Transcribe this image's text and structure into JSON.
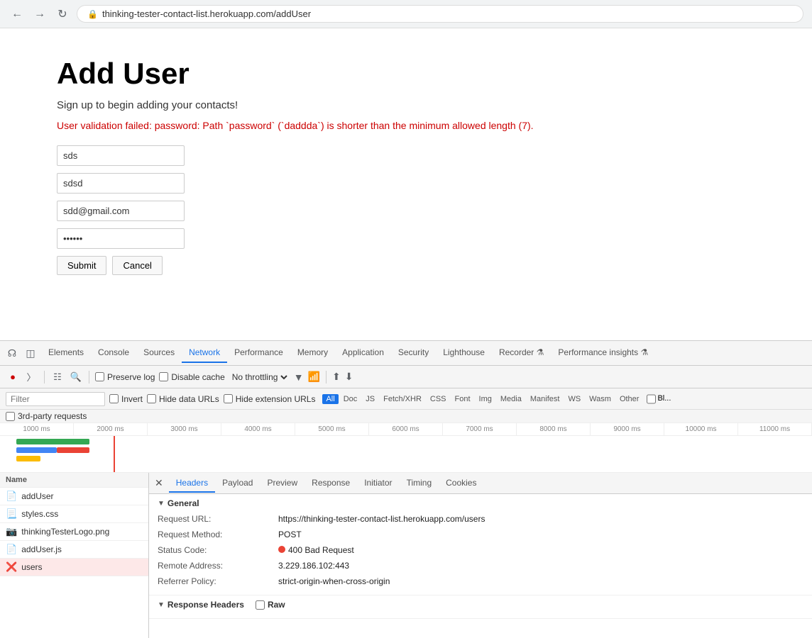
{
  "browser": {
    "back_title": "Back",
    "forward_title": "Forward",
    "refresh_title": "Refresh",
    "url": "thinking-tester-contact-list.herokuapp.com/addUser",
    "lock_icon": "🔒"
  },
  "page": {
    "title": "Add User",
    "subtitle": "Sign up to begin adding your contacts!",
    "error": "User validation failed: password: Path `password` (`daddda`) is shorter than the minimum allowed length (7).",
    "fields": {
      "username": "sds",
      "firstname": "sdsd",
      "email": "sdd@gmail.com",
      "password": "••••••"
    },
    "buttons": {
      "submit": "Submit",
      "cancel": "Cancel"
    }
  },
  "devtools": {
    "tabs": [
      "Elements",
      "Console",
      "Sources",
      "Network",
      "Performance",
      "Memory",
      "Application",
      "Security",
      "Lighthouse",
      "Recorder ⚗",
      "Performance insights ⚗"
    ],
    "active_tab": "Network",
    "toolbar": {
      "preserve_log": "Preserve log",
      "disable_cache": "Disable cache",
      "no_throttling": "No throttling",
      "online_icon": "📶",
      "upload_icon": "⬆",
      "download_icon": "⬇"
    },
    "filter_bar": {
      "placeholder": "Filter",
      "invert": "Invert",
      "hide_data_urls": "Hide data URLs",
      "hide_ext_urls": "Hide extension URLs",
      "types": [
        "All",
        "Doc",
        "JS",
        "Fetch/XHR",
        "CSS",
        "Font",
        "Img",
        "Media",
        "Manifest",
        "WS",
        "Wasm",
        "Other",
        "Bl..."
      ],
      "active_type": "All"
    },
    "third_party": "3rd-party requests",
    "timeline": {
      "marks": [
        "1000 ms",
        "2000 ms",
        "3000 ms",
        "4000 ms",
        "5000 ms",
        "6000 ms",
        "7000 ms",
        "8000 ms",
        "9000 ms",
        "10000 ms",
        "11000 ms"
      ]
    },
    "files": [
      {
        "name": "addUser",
        "icon": "doc",
        "type": "doc"
      },
      {
        "name": "styles.css",
        "icon": "css",
        "type": "css"
      },
      {
        "name": "thinkingTesterLogo.png",
        "icon": "img",
        "type": "img"
      },
      {
        "name": "addUser.js",
        "icon": "js",
        "type": "js"
      },
      {
        "name": "users",
        "icon": "error",
        "type": "error",
        "selected": true
      }
    ],
    "headers_panel": {
      "close": "✕",
      "tabs": [
        "Headers",
        "Payload",
        "Preview",
        "Response",
        "Initiator",
        "Timing",
        "Cookies"
      ],
      "active_tab": "Headers",
      "general_section": "General",
      "general_fields": [
        {
          "key": "Request URL:",
          "value": "https://thinking-tester-contact-list.herokuapp.com/users"
        },
        {
          "key": "Request Method:",
          "value": "POST"
        },
        {
          "key": "Status Code:",
          "value": "400 Bad Request",
          "has_dot": true
        },
        {
          "key": "Remote Address:",
          "value": "3.229.186.102:443"
        },
        {
          "key": "Referrer Policy:",
          "value": "strict-origin-when-cross-origin"
        }
      ],
      "response_headers_section": "Response Headers",
      "raw_label": "Raw"
    }
  }
}
